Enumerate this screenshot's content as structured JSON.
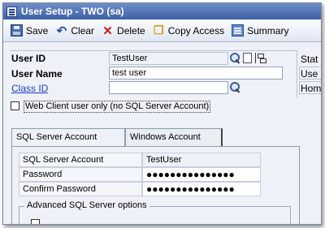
{
  "window": {
    "title": "User Setup  -  TWO (sa)"
  },
  "toolbar": {
    "save": "Save",
    "clear": "Clear",
    "delete": "Delete",
    "copy_access": "Copy Access",
    "summary": "Summary"
  },
  "form": {
    "user_id_label": "User ID",
    "user_id_value": "TestUser",
    "user_name_label": "User Name",
    "user_name_value": "test user",
    "class_id_label": "Class ID",
    "class_id_value": "",
    "right_labels": [
      "Stat",
      "Use",
      "Hom"
    ],
    "web_client_label": "Web Client user only (no SQL Server Account)",
    "web_client_checked": false
  },
  "tabs": {
    "sql": "SQL Server Account",
    "windows": "Windows Account"
  },
  "sql_account": {
    "rows": [
      {
        "label": "SQL Server Account",
        "value": "TestUser"
      },
      {
        "label": "Password",
        "value": "●●●●●●●●●●●●●●●"
      },
      {
        "label": "Confirm Password",
        "value": "●●●●●●●●●●●●●●●"
      }
    ],
    "advanced_title": "Advanced SQL Server options"
  }
}
